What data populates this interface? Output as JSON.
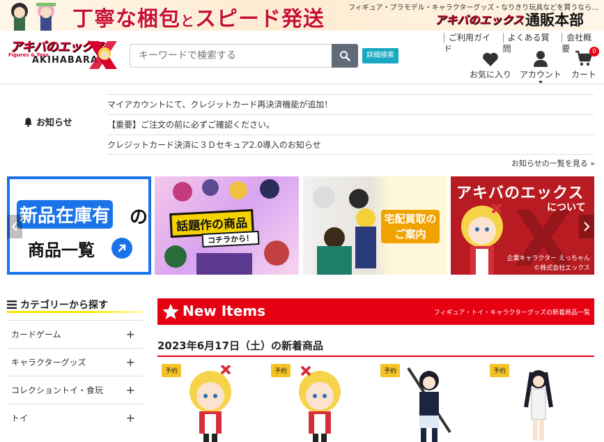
{
  "promo": {
    "slogan_part1": "丁寧な梱包",
    "slogan_and": "と",
    "slogan_part2": "スピード発送",
    "subtitle": "フィギュア・プラモデル・キャラクターグッズ・なりきり玩具などを買うなら…",
    "brand": "アキバのエックス",
    "brand_suffix": "通販本部"
  },
  "header": {
    "logo": {
      "main": "アキバのエックス",
      "small": "Figures & Toys",
      "sub": "AKIHABARA"
    },
    "search": {
      "placeholder": "キーワードで検索する"
    },
    "advanced_search": "詳細検索",
    "top_links": [
      "ご利用ガイド",
      "よくある質問",
      "会社概要"
    ],
    "favorites": "お気に入り",
    "account": "アカウント",
    "cart": "カート",
    "cart_count": "0"
  },
  "news": {
    "heading": "お知らせ",
    "items": [
      "マイアカウントにて、クレジットカード再決済機能が追加！",
      "【重要】ご注文の前に必ずご確認ください。",
      "クレジットカード決済に３Ｄセキュア2.0導入のお知らせ"
    ],
    "more": "お知らせの一覧を見る »"
  },
  "carousel": {
    "slide1": {
      "line1": "新品在庫有",
      "line1b": "の",
      "line2": "商品一覧"
    },
    "slide2": {
      "label": "話題作の商品",
      "sub": "コチラから！"
    },
    "slide3": {
      "label": "宅配買取の ご案内"
    },
    "slide4": {
      "title": "アキバのエックス",
      "sub": "について",
      "caption1": "企業キャラクター えっちゃん",
      "caption2": "©株式会社エックス"
    }
  },
  "categories": {
    "title": "カテゴリーから探す",
    "items": [
      "カードゲーム",
      "キャラクターグッズ",
      "コレクショントイ・食玩",
      "トイ"
    ]
  },
  "new_items": {
    "title": "New Items",
    "subtitle": "フィギュア・トイ・キャラクターグッズの新着商品一覧",
    "date": "2023年6月17日（土）の新着商品",
    "products": [
      {
        "badge": "予約"
      },
      {
        "badge": "予約"
      },
      {
        "badge": "予約"
      },
      {
        "badge": "予約"
      }
    ]
  },
  "colors": {
    "brand_red": "#e60012",
    "accent_blue": "#1a73e8",
    "search_teal": "#18a8c2"
  }
}
